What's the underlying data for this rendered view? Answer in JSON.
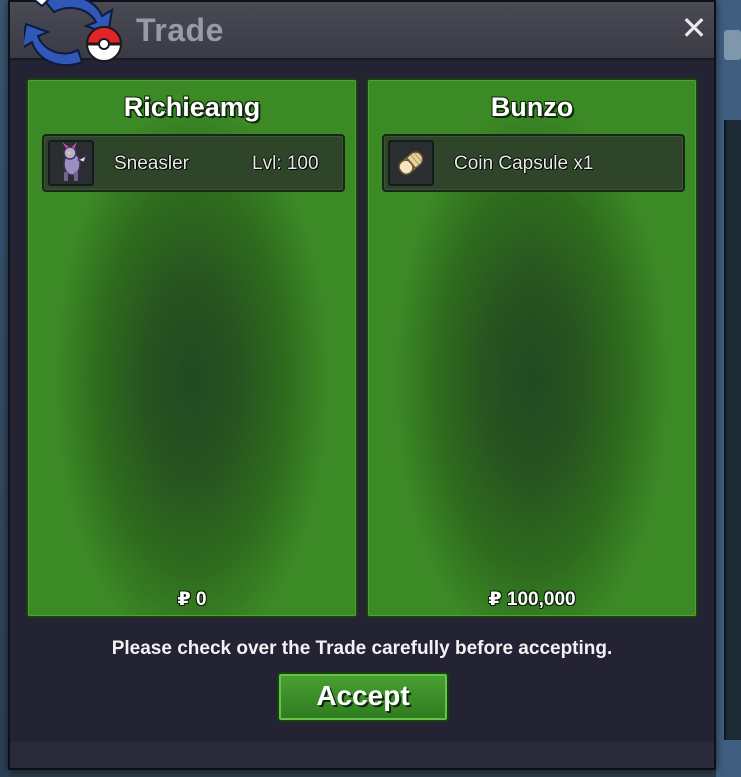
{
  "window": {
    "title": "Trade",
    "close_glyph": "✕"
  },
  "left_panel": {
    "name": "Richieamg",
    "item": {
      "icon": "sneasler-sprite-icon",
      "name": "Sneasler",
      "level": "Lvl: 100"
    },
    "money": "₽ 0"
  },
  "right_panel": {
    "name": "Bunzo",
    "item": {
      "icon": "coin-capsule-icon",
      "name": "Coin Capsule  x1"
    },
    "money": "₽ 100,000"
  },
  "notice": "Please check over the Trade carefully before accepting.",
  "accept_label": "Accept",
  "colors": {
    "panel_green": "#2f6d1e",
    "panel_dark": "#1f4a22",
    "window_bg": "#232333",
    "titlebar": "#3b3b46",
    "button_green": "#3e9129"
  }
}
